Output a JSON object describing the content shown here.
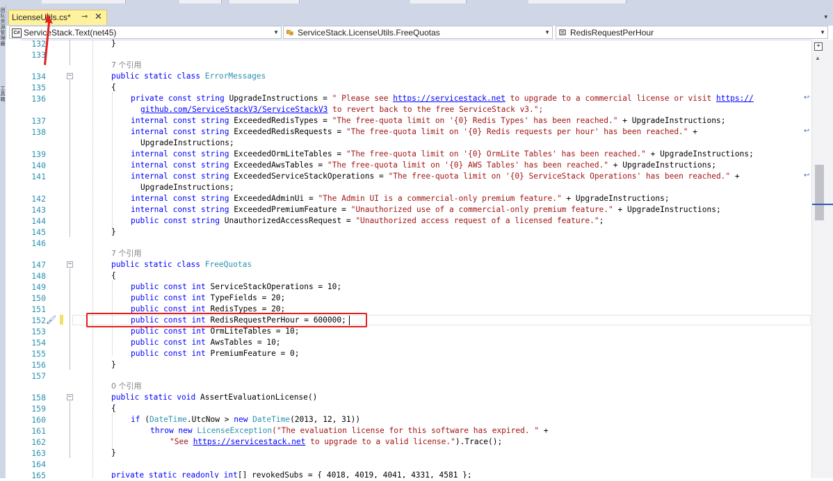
{
  "tab": {
    "title": "LicenseUtils.cs*",
    "pin_glyph": "⊸",
    "close_glyph": "✕",
    "menu_glyph": "▾"
  },
  "left_tool": {
    "labels": [
      "团队资源管理器",
      "工具箱"
    ]
  },
  "nav": {
    "project": {
      "icon": "C#",
      "value": "ServiceStack.Text(net45)"
    },
    "type": {
      "value": "ServiceStack.LicenseUtils.FreeQuotas"
    },
    "member": {
      "value": "RedisRequestPerHour"
    }
  },
  "editor": {
    "line_numbers": [
      "132",
      "133",
      "134",
      "135",
      "136",
      "137",
      "138",
      "139",
      "140",
      "141",
      "142",
      "143",
      "144",
      "145",
      "146",
      "147",
      "148",
      "149",
      "150",
      "151",
      "152",
      "153",
      "154",
      "155",
      "156",
      "157",
      "158",
      "159",
      "160",
      "161",
      "162",
      "163",
      "164",
      "165"
    ],
    "codelens": {
      "error_messages": "7 个引用",
      "free_quotas": "7 个引用",
      "assert_eval": "0 个引用"
    },
    "code": {
      "l132": "}",
      "l134_mod": "public static class ",
      "l134_name": "ErrorMessages",
      "l135": "{",
      "l136_a": "private const string UpgradeInstructions = ",
      "l136_b": "\" Please see ",
      "l136_url1": "https://servicestack.net",
      "l136_c": " to upgrade to a commercial license or visit ",
      "l136_url2": "https://",
      "l136_url3": "github.com/ServiceStackV3/ServiceStackV3",
      "l136_d": " to revert back to the free ServiceStack v3.\";",
      "l137_a": "internal const string ExceededRedisTypes = ",
      "l137_s": "\"The free-quota limit on '{0} Redis Types' has been reached.\"",
      "l137_b": " + UpgradeInstructions;",
      "l138_a": "internal const string ExceededRedisRequests = ",
      "l138_s": "\"The free-quota limit on '{0} Redis requests per hour' has been reached.\"",
      "l138_b": " +",
      "l138_wrap": "UpgradeInstructions;",
      "l139_a": "internal const string ExceededOrmLiteTables = ",
      "l139_s": "\"The free-quota limit on '{0} OrmLite Tables' has been reached.\"",
      "l139_b": " + UpgradeInstructions;",
      "l140_a": "internal const string ExceededAwsTables = ",
      "l140_s": "\"The free-quota limit on '{0} AWS Tables' has been reached.\"",
      "l140_b": " + UpgradeInstructions;",
      "l141_a": "internal const string ExceededServiceStackOperations = ",
      "l141_s": "\"The free-quota limit on '{0} ServiceStack Operations' has been reached.\"",
      "l141_b": " +",
      "l141_wrap": "UpgradeInstructions;",
      "l142_a": "internal const string ExceededAdminUi = ",
      "l142_s": "\"The Admin UI is a commercial-only premium feature.\"",
      "l142_b": " + UpgradeInstructions;",
      "l143_a": "internal const string ExceededPremiumFeature = ",
      "l143_s": "\"Unauthorized use of a commercial-only premium feature.\"",
      "l143_b": " + UpgradeInstructions;",
      "l144_a": "public const string UnauthorizedAccessRequest = ",
      "l144_s": "\"Unauthorized access request of a licensed feature.\"",
      "l144_b": ";",
      "l145": "}",
      "l147_mod": "public static class ",
      "l147_name": "FreeQuotas",
      "l148": "{",
      "l149": "public const int ServiceStackOperations = 10;",
      "l150": "public const int TypeFields = 20;",
      "l151": "public const int RedisTypes = 20;",
      "l152": "public const int RedisRequestPerHour = 600000;",
      "l153": "public const int OrmLiteTables = 10;",
      "l154": "public const int AwsTables = 10;",
      "l155": "public const int PremiumFeature = 0;",
      "l156": "}",
      "l158": "public static void AssertEvaluationLicense()",
      "l159": "{",
      "l160_a": "if (",
      "l160_t1": "DateTime",
      "l160_b": ".UtcNow > new ",
      "l160_t2": "DateTime",
      "l160_c": "(2013, 12, 31))",
      "l161_a": "throw new ",
      "l161_t": "LicenseException",
      "l161_s": "(\"The evaluation license for this software has expired. \"",
      "l161_b": " +",
      "l162_s1": "\"See ",
      "l162_url": "https://servicestack.net",
      "l162_s2": " to upgrade to a valid license.\"",
      "l162_b": ").Trace();",
      "l163": "}",
      "l165": "private static readonly int[] revokedSubs = { 4018, 4019, 4041, 4331, 4581 };"
    }
  },
  "colors": {
    "keyword": "#0000ff",
    "type": "#2b91af",
    "string": "#a31515",
    "highlight_box": "#e02020",
    "tab_active": "#fff29d"
  }
}
